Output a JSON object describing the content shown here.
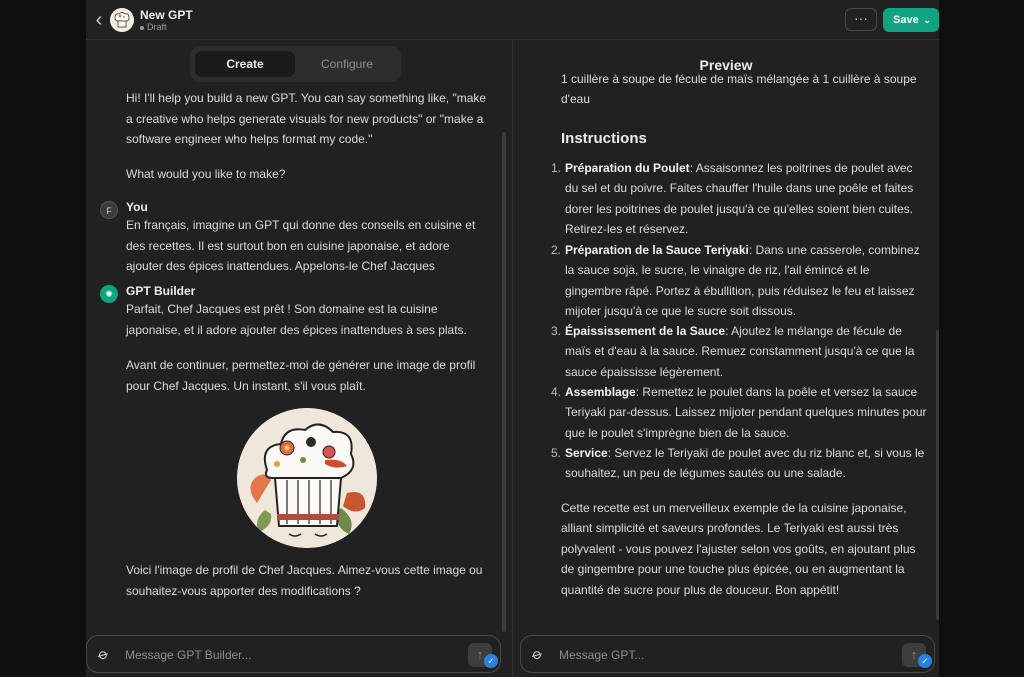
{
  "header": {
    "back_icon": "chevron-left-icon",
    "title": "New GPT",
    "status": "Draft",
    "more_label": "···",
    "save_label": "Save",
    "save_chevron": "⌄",
    "accent_color": "#10a37f"
  },
  "tabs": [
    {
      "label": "Create",
      "active": true
    },
    {
      "label": "Configure",
      "active": false
    }
  ],
  "left": {
    "intro": "Hi! I'll help you build a new GPT. You can say something like, \"make a creative who helps generate visuals for new products\" or \"make a software engineer who helps format my code.\"",
    "question": "What would you like to make?",
    "user_avatar": "F",
    "user_name": "You",
    "user_message": "En français, imagine un GPT qui donne des conseils en cuisine et des recettes. Il est surtout bon en cuisine japonaise, et adore ajouter des épices inattendues. Appelons-le Chef Jacques",
    "builder_name": "GPT Builder",
    "builder_message_1": "Parfait, Chef Jacques est prêt ! Son domaine est la cuisine japonaise, et il adore ajouter des épices inattendues à ses plats.",
    "builder_message_2": "Avant de continuer, permettez-moi de générer une image de profil pour Chef Jacques. Un instant, s'il vous plaît.",
    "builder_message_3": "Voici l'image de profil de Chef Jacques. Aimez-vous cette image ou souhaitez-vous apporter des modifications ?",
    "input_placeholder": "Message GPT Builder..."
  },
  "right": {
    "preview_title": "Preview",
    "partial_text": "1 cuillère à soupe de fécule de maïs mélangée à 1 cuillère à soupe d'eau",
    "instructions_heading": "Instructions",
    "steps": [
      {
        "num": "1.",
        "title": "Préparation du Poulet",
        "text": ": Assaisonnez les poitrines de poulet avec du sel et du poivre. Faites chauffer l'huile dans une poêle et faites dorer les poitrines de poulet jusqu'à ce qu'elles soient bien cuites. Retirez-les et réservez."
      },
      {
        "num": "2.",
        "title": "Préparation de la Sauce Teriyaki",
        "text": ": Dans une casserole, combinez la sauce soja, le sucre, le vinaigre de riz, l'ail émincé et le gingembre râpé. Portez à ébullition, puis réduisez le feu et laissez mijoter jusqu'à ce que le sucre soit dissous."
      },
      {
        "num": "3.",
        "title": "Épaississement de la Sauce",
        "text": ": Ajoutez le mélange de fécule de maïs et d'eau à la sauce. Remuez constamment jusqu'à ce que la sauce épaississe légèrement."
      },
      {
        "num": "4.",
        "title": "Assemblage",
        "text": ": Remettez le poulet dans la poêle et versez la sauce Teriyaki par-dessus. Laissez mijoter pendant quelques minutes pour que le poulet s'imprègne bien de la sauce."
      },
      {
        "num": "5.",
        "title": "Service",
        "text": ": Servez le Teriyaki de poulet avec du riz blanc et, si vous le souhaitez, un peu de légumes sautés ou une salade."
      }
    ],
    "closing": "Cette recette est un merveilleux exemple de la cuisine japonaise, alliant simplicité et saveurs profondes. Le Teriyaki est aussi très polyvalent - vous pouvez l'ajuster selon vos goûts, en ajoutant plus de gingembre pour une touche plus épicée, ou en augmentant la quantité de sucre pour plus de douceur. Bon appétit!",
    "input_placeholder": "Message GPT..."
  },
  "icons": {
    "attach": "paperclip-icon",
    "send": "arrow-up-icon",
    "badge": "check-badge-icon"
  },
  "glyphs": {
    "back": "‹",
    "gpt_logo": "✺",
    "attach": "⌀",
    "send": "↑",
    "badge": "✓"
  }
}
